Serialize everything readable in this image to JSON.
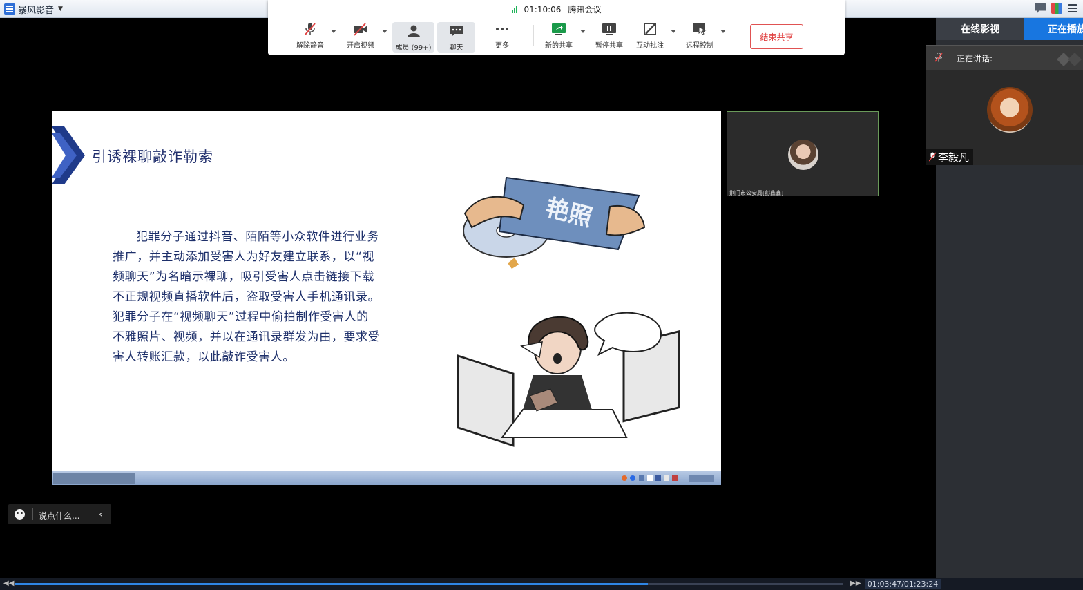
{
  "player": {
    "app_name": "暴风影音",
    "progress_fraction": 0.765,
    "time_display": "01:03:47/01:23:24"
  },
  "meeting": {
    "elapsed": "01:10:06",
    "app_title": "腾讯会议",
    "tools": {
      "unmute": "解除静音",
      "start_video": "开启视频",
      "members": "成员 (99+)",
      "chat": "聊天",
      "more": "更多",
      "new_share": "新的共享",
      "pause_share": "暂停共享",
      "annotate": "互动批注",
      "remote_control": "远程控制"
    },
    "end_share": "结束共享"
  },
  "slide": {
    "title": "引诱裸聊敲诈勒索",
    "body_lines": [
      "犯罪分子通过抖音、陌陌等小众软件进行业务",
      "推广，并主动添加受害人为好友建立联系，以“视",
      "频聊天”为名暗示裸聊，吸引受害人点击链接下载",
      "不正规视频直播软件后，盗取受害人手机通讯录。",
      "犯罪分子在“视频聊天”过程中偷拍制作受害人的",
      "不雅照片、视频，并以在通讯录群发为由，要求受",
      "害人转账汇款，以此敲诈受害人。"
    ],
    "illustration_text": "艳照"
  },
  "thumbnail": {
    "caption": "荆门市公安局[彭鑫鑫]"
  },
  "right_panel": {
    "tab_online": "在线影视",
    "tab_playing": "正在播放"
  },
  "speaking": {
    "label": "正在讲话:",
    "speaker_name": "李毅凡"
  },
  "chat": {
    "placeholder": "说点什么..."
  },
  "colors": {
    "accent_blue": "#1876e0",
    "end_share_red": "#e04040",
    "slide_text": "#1d2f6a"
  }
}
